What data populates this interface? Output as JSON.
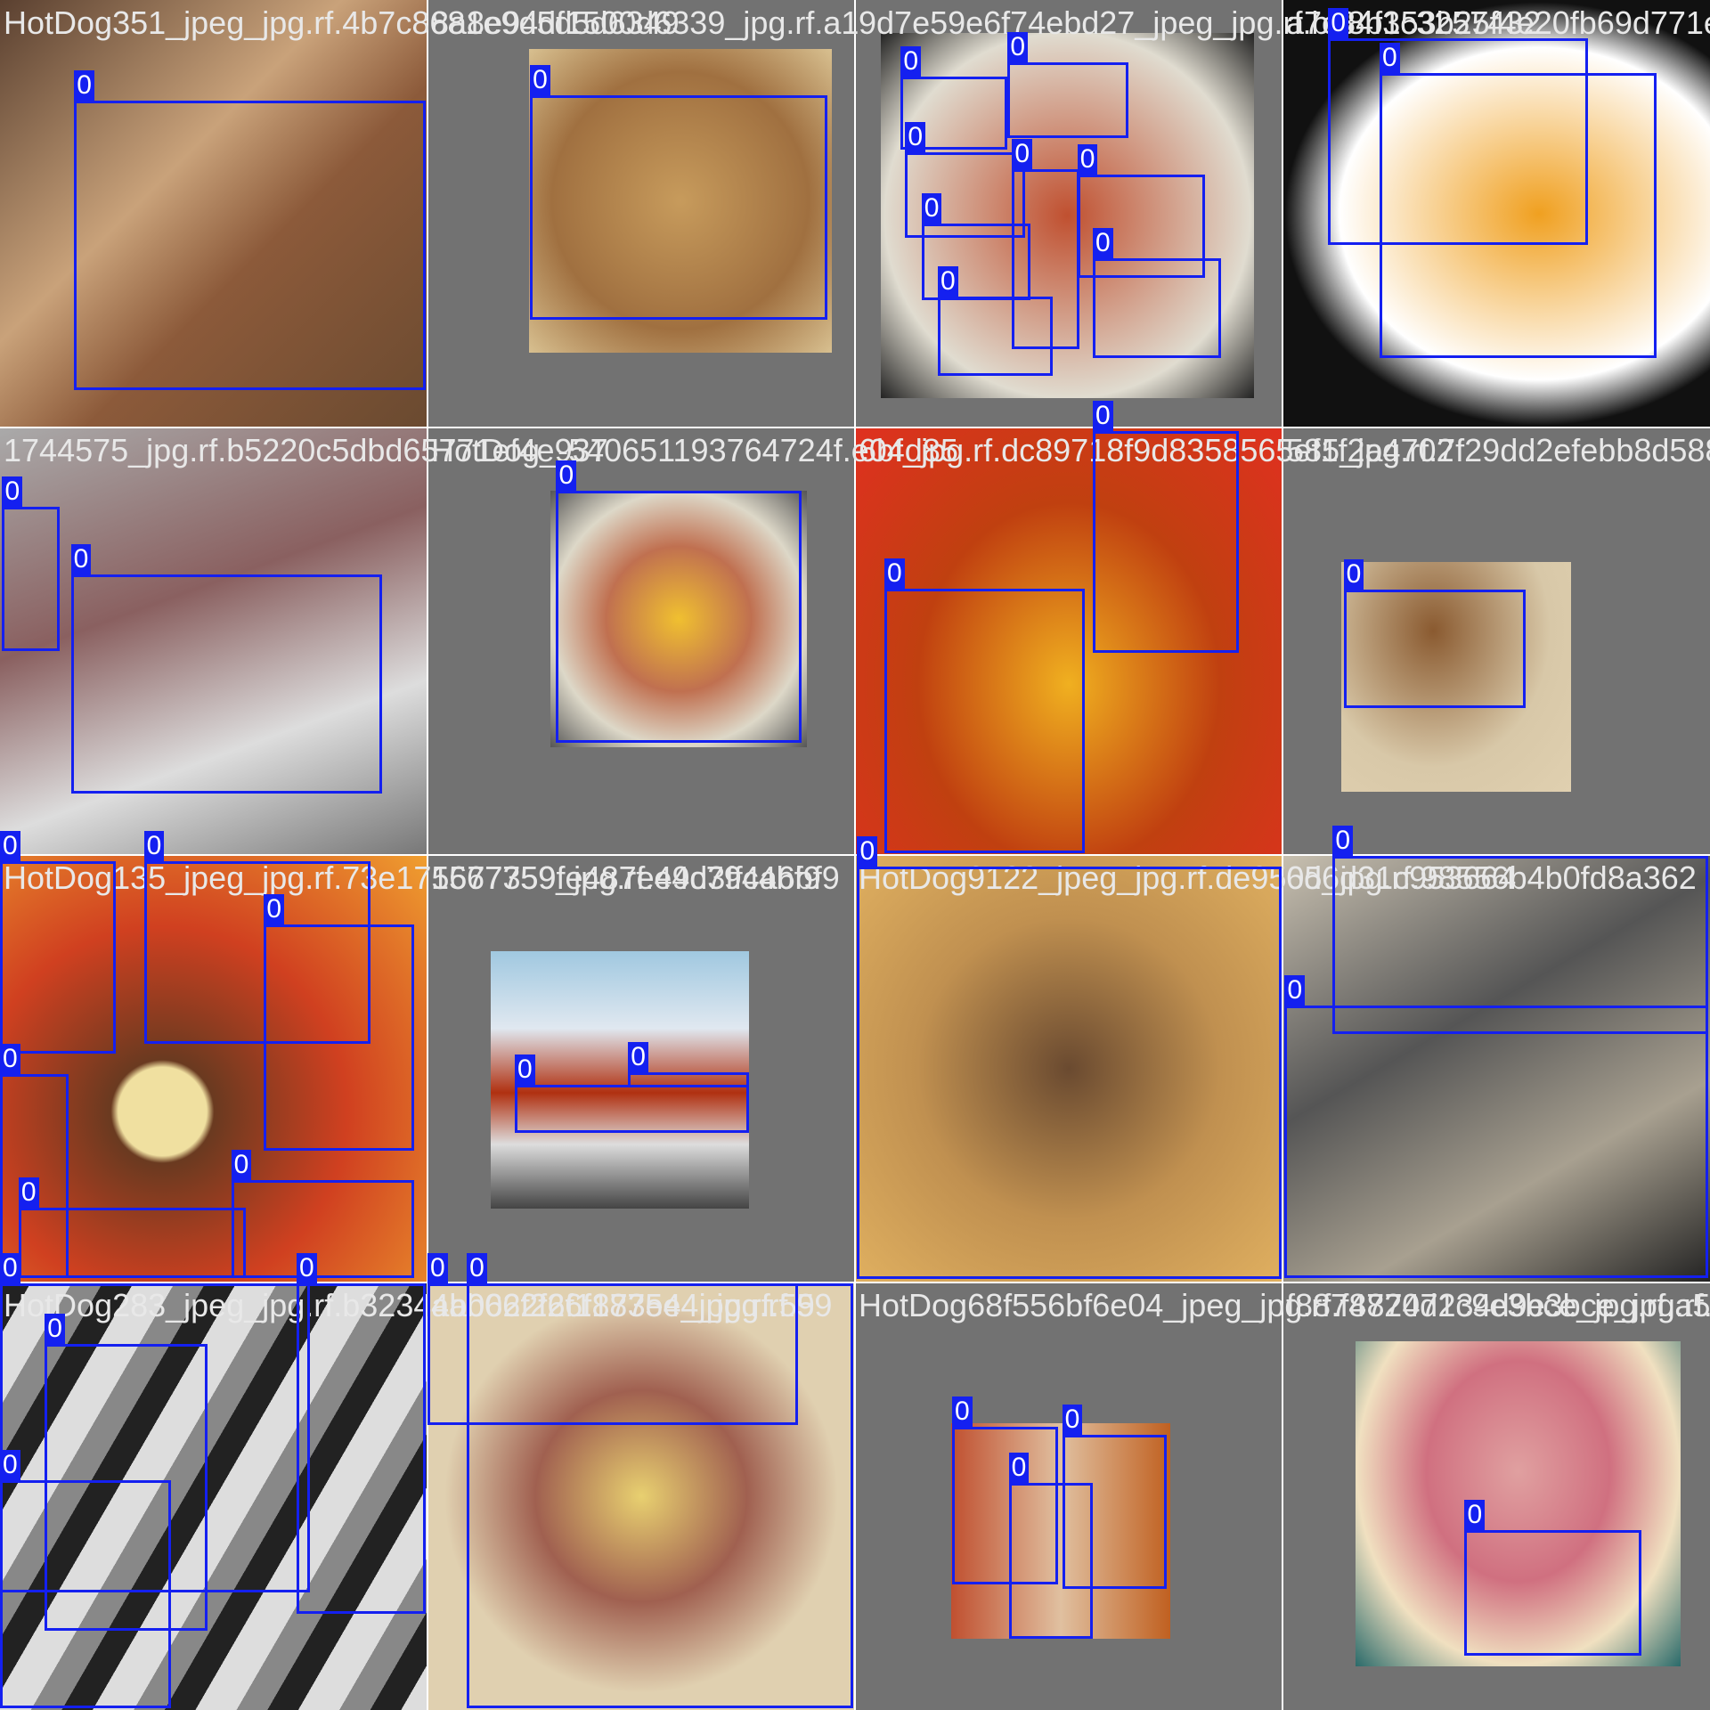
{
  "tiles": [
    {
      "filename": "HotDog351_jpeg_jpg.rf.4b7c8681e9d5d5d6349",
      "classes": [
        "0"
      ]
    },
    {
      "filename": "8a8e94df1500d6339_jpg.rf.a1",
      "classes": [
        "0"
      ]
    },
    {
      "filename": "9d7e59e6f74ebd27_jpeg_jpg.rf.b78b153b25f4e20fb69d771e7",
      "classes": [
        "0",
        "0",
        "0",
        "0",
        "0",
        "0",
        "0",
        "0"
      ]
    },
    {
      "filename": "a7c84f3c3257432",
      "classes": [
        "0",
        "0"
      ]
    },
    {
      "filename": "1744575_jpg.rf.b5220c5dbd65771ef4e937",
      "classes": [
        "0",
        "0"
      ]
    },
    {
      "filename": "HotDog_-540651193764724f.e04d85",
      "classes": [
        "0"
      ]
    },
    {
      "filename": "6bf_jpg.rf.dc89718f9d8358565ef1f2a4702",
      "classes": [
        "0",
        "0"
      ]
    },
    {
      "filename": "585_jpg.rf.7f29dd2efebb8d588",
      "classes": [
        "0"
      ]
    },
    {
      "filename": "HotDog135_jpeg_jpg.rf.73e175677359fe487e49c794a6bf9",
      "classes": [
        "0",
        "0",
        "0",
        "0",
        "0",
        "0"
      ]
    },
    {
      "filename": "1567759_jpg.rf.e4d3ffc4bf9",
      "classes": [
        "0",
        "0"
      ]
    },
    {
      "filename": "HotDog9122_jpeg_jpg.rf.de9505_jpg.rf.98556b4b0fd8a362",
      "classes": [
        "0"
      ]
    },
    {
      "filename": "6d6d31c953664",
      "classes": [
        "0",
        "0"
      ]
    },
    {
      "filename": "HotDog283_jpeg_jpg.rf.b3234ab062f26f1873e4_jpg.rf.59",
      "classes": [
        "0",
        "0",
        "0",
        "0"
      ]
    },
    {
      "filename": "4ab062f26f1875e4_jpg.rf.59",
      "classes": [
        "0",
        "0"
      ]
    },
    {
      "filename": "HotDog68f556bf6e04_jpeg_jpg.rf.f88747234d9e3bce_jpg.rf.a5",
      "classes": [
        "0",
        "0",
        "0"
      ]
    },
    {
      "filename": "f8874720d1c9e3bce_jpg.rf.a5",
      "classes": [
        "0"
      ]
    }
  ],
  "colors": {
    "box": "#1420f0",
    "background": "#727272",
    "label_text": "#e8e8e8"
  }
}
